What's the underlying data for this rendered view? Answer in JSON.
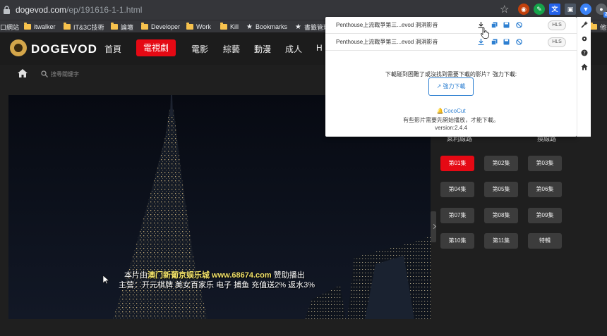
{
  "browser": {
    "url_domain": "dogevod.com",
    "url_path": "/ep/191616-1-1.html",
    "bookmarks": [
      {
        "label": "口網站",
        "type": "text"
      },
      {
        "label": "itwalker",
        "type": "folder"
      },
      {
        "label": "IT&3C技術",
        "type": "folder"
      },
      {
        "label": "論壇",
        "type": "folder"
      },
      {
        "label": "Developer",
        "type": "folder"
      },
      {
        "label": "Work",
        "type": "folder"
      },
      {
        "label": "Kill",
        "type": "folder"
      },
      {
        "label": "Bookmarks",
        "type": "star"
      },
      {
        "label": "書籤管理",
        "type": "star"
      },
      {
        "label": "他書籤",
        "type": "folder"
      }
    ],
    "ext_badge": "2"
  },
  "site": {
    "logo": "DOGEVOD",
    "nav": [
      {
        "label": "首頁",
        "active": false
      },
      {
        "label": "電視劇",
        "active": true
      },
      {
        "label": "電影",
        "active": false
      },
      {
        "label": "綜藝",
        "active": false
      },
      {
        "label": "動漫",
        "active": false
      },
      {
        "label": "成人",
        "active": false
      },
      {
        "label": "H",
        "active": false
      }
    ],
    "search_placeholder": "搜尋關鍵字"
  },
  "video": {
    "subtitle_line1_pre": "本片由",
    "subtitle_line1_hl": "澳门新葡京娱乐城 www.68674.com",
    "subtitle_line1_post": " 赞助播出",
    "subtitle_line2": "主营：开元棋牌 美女百家乐 电子 捕鱼 充值送2% 返水3%"
  },
  "lines": {
    "left": "萊利線路",
    "right": "換線路"
  },
  "episodes": [
    {
      "label": "第01集",
      "active": true
    },
    {
      "label": "第02集",
      "active": false
    },
    {
      "label": "第03集",
      "active": false
    },
    {
      "label": "第04集",
      "active": false
    },
    {
      "label": "第05集",
      "active": false
    },
    {
      "label": "第06集",
      "active": false
    },
    {
      "label": "第07集",
      "active": false
    },
    {
      "label": "第08集",
      "active": false
    },
    {
      "label": "第09集",
      "active": false
    },
    {
      "label": "第10集",
      "active": false
    },
    {
      "label": "第11集",
      "active": false
    },
    {
      "label": "特輯",
      "active": false
    }
  ],
  "popup": {
    "rows": [
      {
        "title": "Penthouse上流戰爭第三...evod 洞洞影音",
        "format": "HLS"
      },
      {
        "title": "Penthouse上流戰爭第三...evod 洞洞影音",
        "format": "HLS"
      }
    ],
    "message": "下載碰到困難了或沒找到需要下載的影片？強力下載:",
    "force_button": "強力下載",
    "brand": "CocoCut",
    "note": "有些影片需要先開始播放，才能下載。",
    "version": "version:2.4.4"
  },
  "colors": {
    "accent": "#e50914",
    "popup_link": "#2d7fd1"
  }
}
